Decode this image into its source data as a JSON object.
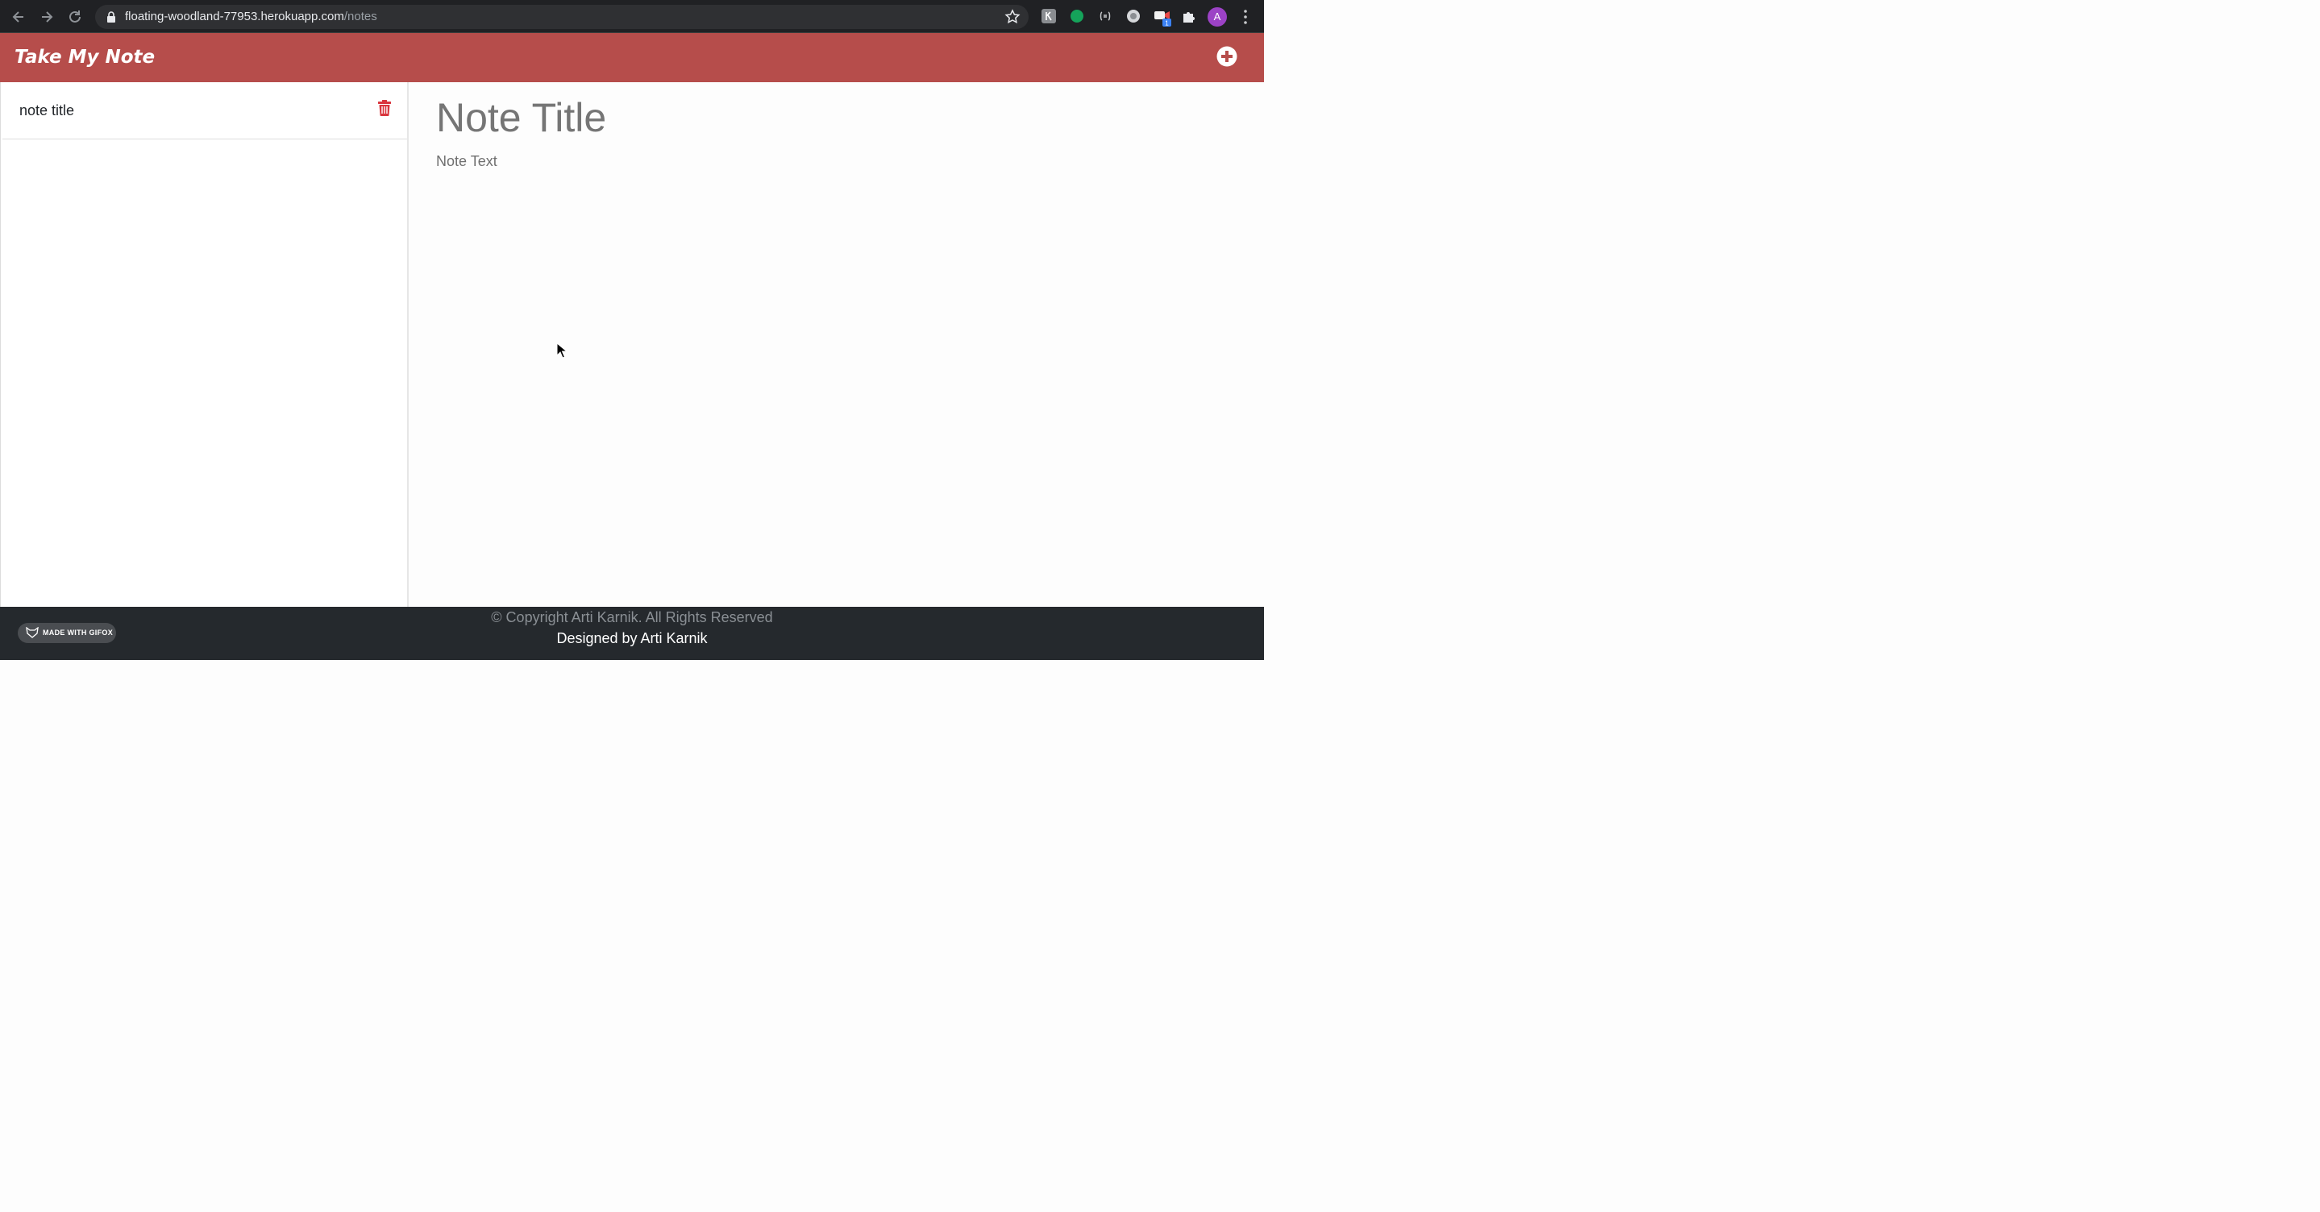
{
  "browser": {
    "url_host": "floating-woodland-77953.herokuapp.com",
    "url_path": "/notes",
    "back_icon": "arrow-left-icon",
    "forward_icon": "arrow-right-icon",
    "reload_icon": "reload-icon",
    "profile_initial": "A",
    "extension_badge": "1"
  },
  "header": {
    "brand": "Take My Note",
    "add_icon": "plus-circle-icon"
  },
  "sidebar": {
    "notes": [
      {
        "title": "note title"
      }
    ]
  },
  "editor": {
    "title_placeholder": "Note Title",
    "text_placeholder": "Note Text"
  },
  "footer": {
    "copyright": "© Copyright Arti Karnik. All Rights Reserved",
    "designed_by": "Designed by Arti Karnik",
    "badge": "MADE WITH GIFOX"
  },
  "colors": {
    "header_bg": "#b64d4b",
    "trash": "#d9363e",
    "footer_bg": "#25292d"
  }
}
